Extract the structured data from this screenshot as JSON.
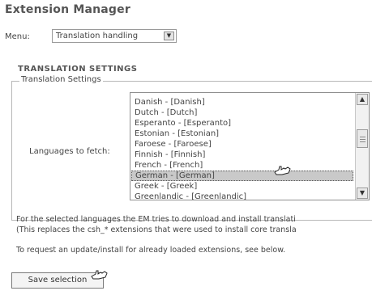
{
  "page": {
    "title": "Extension Manager"
  },
  "menu": {
    "label": "Menu:",
    "selected": "Translation handling"
  },
  "section": {
    "heading": "TRANSLATION SETTINGS",
    "legend": "Translation Settings",
    "fetch_label": "Languages to fetch:"
  },
  "languages": {
    "items": [
      {
        "label": "Danish - [Danish]",
        "selected": false
      },
      {
        "label": "Dutch - [Dutch]",
        "selected": false
      },
      {
        "label": "Esperanto - [Esperanto]",
        "selected": false
      },
      {
        "label": "Estonian - [Estonian]",
        "selected": false
      },
      {
        "label": "Faroese - [Faroese]",
        "selected": false
      },
      {
        "label": "Finnish - [Finnish]",
        "selected": false
      },
      {
        "label": "French - [French]",
        "selected": false
      },
      {
        "label": "German - [German]",
        "selected": true
      },
      {
        "label": "Greek - [Greek]",
        "selected": false
      },
      {
        "label": "Greenlandic - [Greenlandic]",
        "selected": false
      }
    ]
  },
  "info": {
    "line1": "For the selected languages the EM tries to download and install translati",
    "line2": "(This replaces the csh_* extensions that were used to install core transla",
    "line3": "To request an update/install for already loaded extensions, see below."
  },
  "buttons": {
    "save": "Save selection"
  },
  "icons": {
    "dropdown": "chevron-down-icon",
    "scroll_up": "chevron-up-icon",
    "scroll_down": "chevron-down-icon",
    "cursor": "hand-pointer-icon"
  }
}
